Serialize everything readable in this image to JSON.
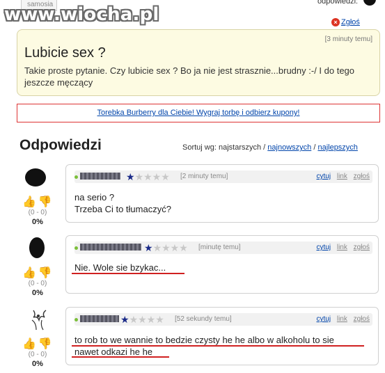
{
  "top": {
    "avatar_label": "samosia",
    "answers_label": "odpowiedzi:",
    "watermark": "www.wiocha.pl",
    "report_label": "Zgłoś"
  },
  "question": {
    "time": "[3 minuty temu]",
    "title": "Lubicie sex ?",
    "body": "Takie proste pytanie. Czy lubicie sex ? Bo ja nie jest strasznie...brudny :-/ I do tego jeszcze męczący"
  },
  "ad": {
    "text": "Torebka Burberry dla Ciebie! Wygraj torbę i odbierz kupony!"
  },
  "answers_header": {
    "title": "Odpowiedzi",
    "sort_prefix": "Sortuj wg: najstarszych /",
    "sort_newest": "najnowszych",
    "sort_sep": "/",
    "sort_best": "najlepszych"
  },
  "answers": [
    {
      "time": "[2 minuty temu]",
      "lines": [
        "na serio ?",
        "Trzeba Ci to tłumaczyć?"
      ],
      "score": "(0 - 0)",
      "percent": "0%",
      "links": {
        "quote": "cytuj",
        "link": "link",
        "report": "zgłoś"
      }
    },
    {
      "time": "[minutę temu]",
      "lines": [
        "Nie. Wole sie bzykac..."
      ],
      "score": "(0 - 0)",
      "percent": "0%",
      "links": {
        "quote": "cytuj",
        "link": "link",
        "report": "zgłoś"
      }
    },
    {
      "time": "[52 sekundy temu]",
      "lines": [
        "to rob to we wannie to bedzie czysty he he albo w alkoholu to sie",
        "nawet odkazi he he"
      ],
      "score": "(0 - 0)",
      "percent": "0%",
      "links": {
        "quote": "cytuj",
        "link": "link",
        "report": "zgłoś"
      }
    }
  ],
  "colors": {
    "question_bg": "#fdfbe2",
    "link": "#0044aa",
    "ad_border": "#dd3333",
    "star_on": "#1a2a88",
    "underline": "#d02020"
  }
}
